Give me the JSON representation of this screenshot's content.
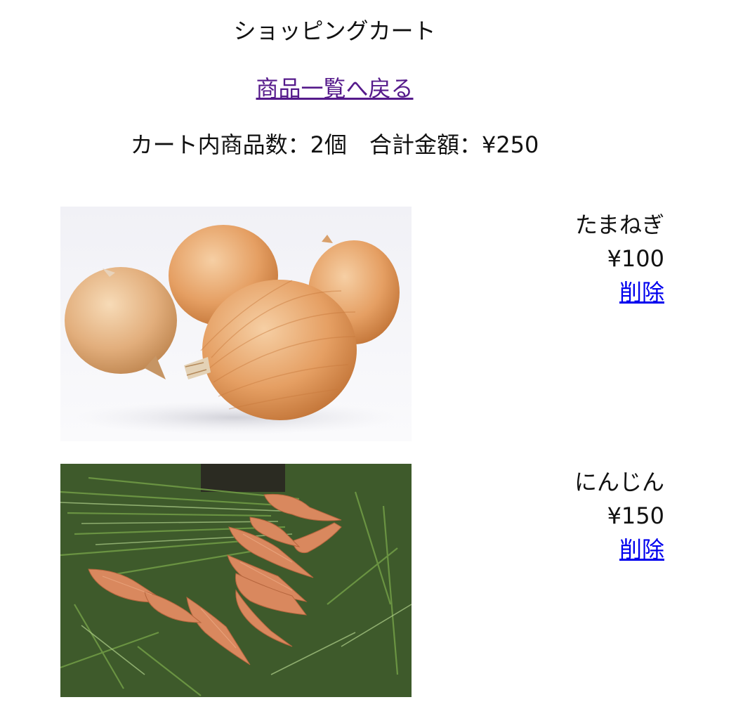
{
  "page": {
    "title": "ショッピングカート",
    "back_link": "商品一覧へ戻る",
    "summary": "カート内商品数：2個　合計金額：¥250"
  },
  "items": [
    {
      "name": "たまねぎ",
      "price": "¥100",
      "delete_label": "削除",
      "image": "onion-photo"
    },
    {
      "name": "にんじん",
      "price": "¥150",
      "delete_label": "削除",
      "image": "carrot-photo"
    }
  ],
  "colors": {
    "visited_link": "#551a8b",
    "link": "#0000ee",
    "text": "#111111"
  }
}
